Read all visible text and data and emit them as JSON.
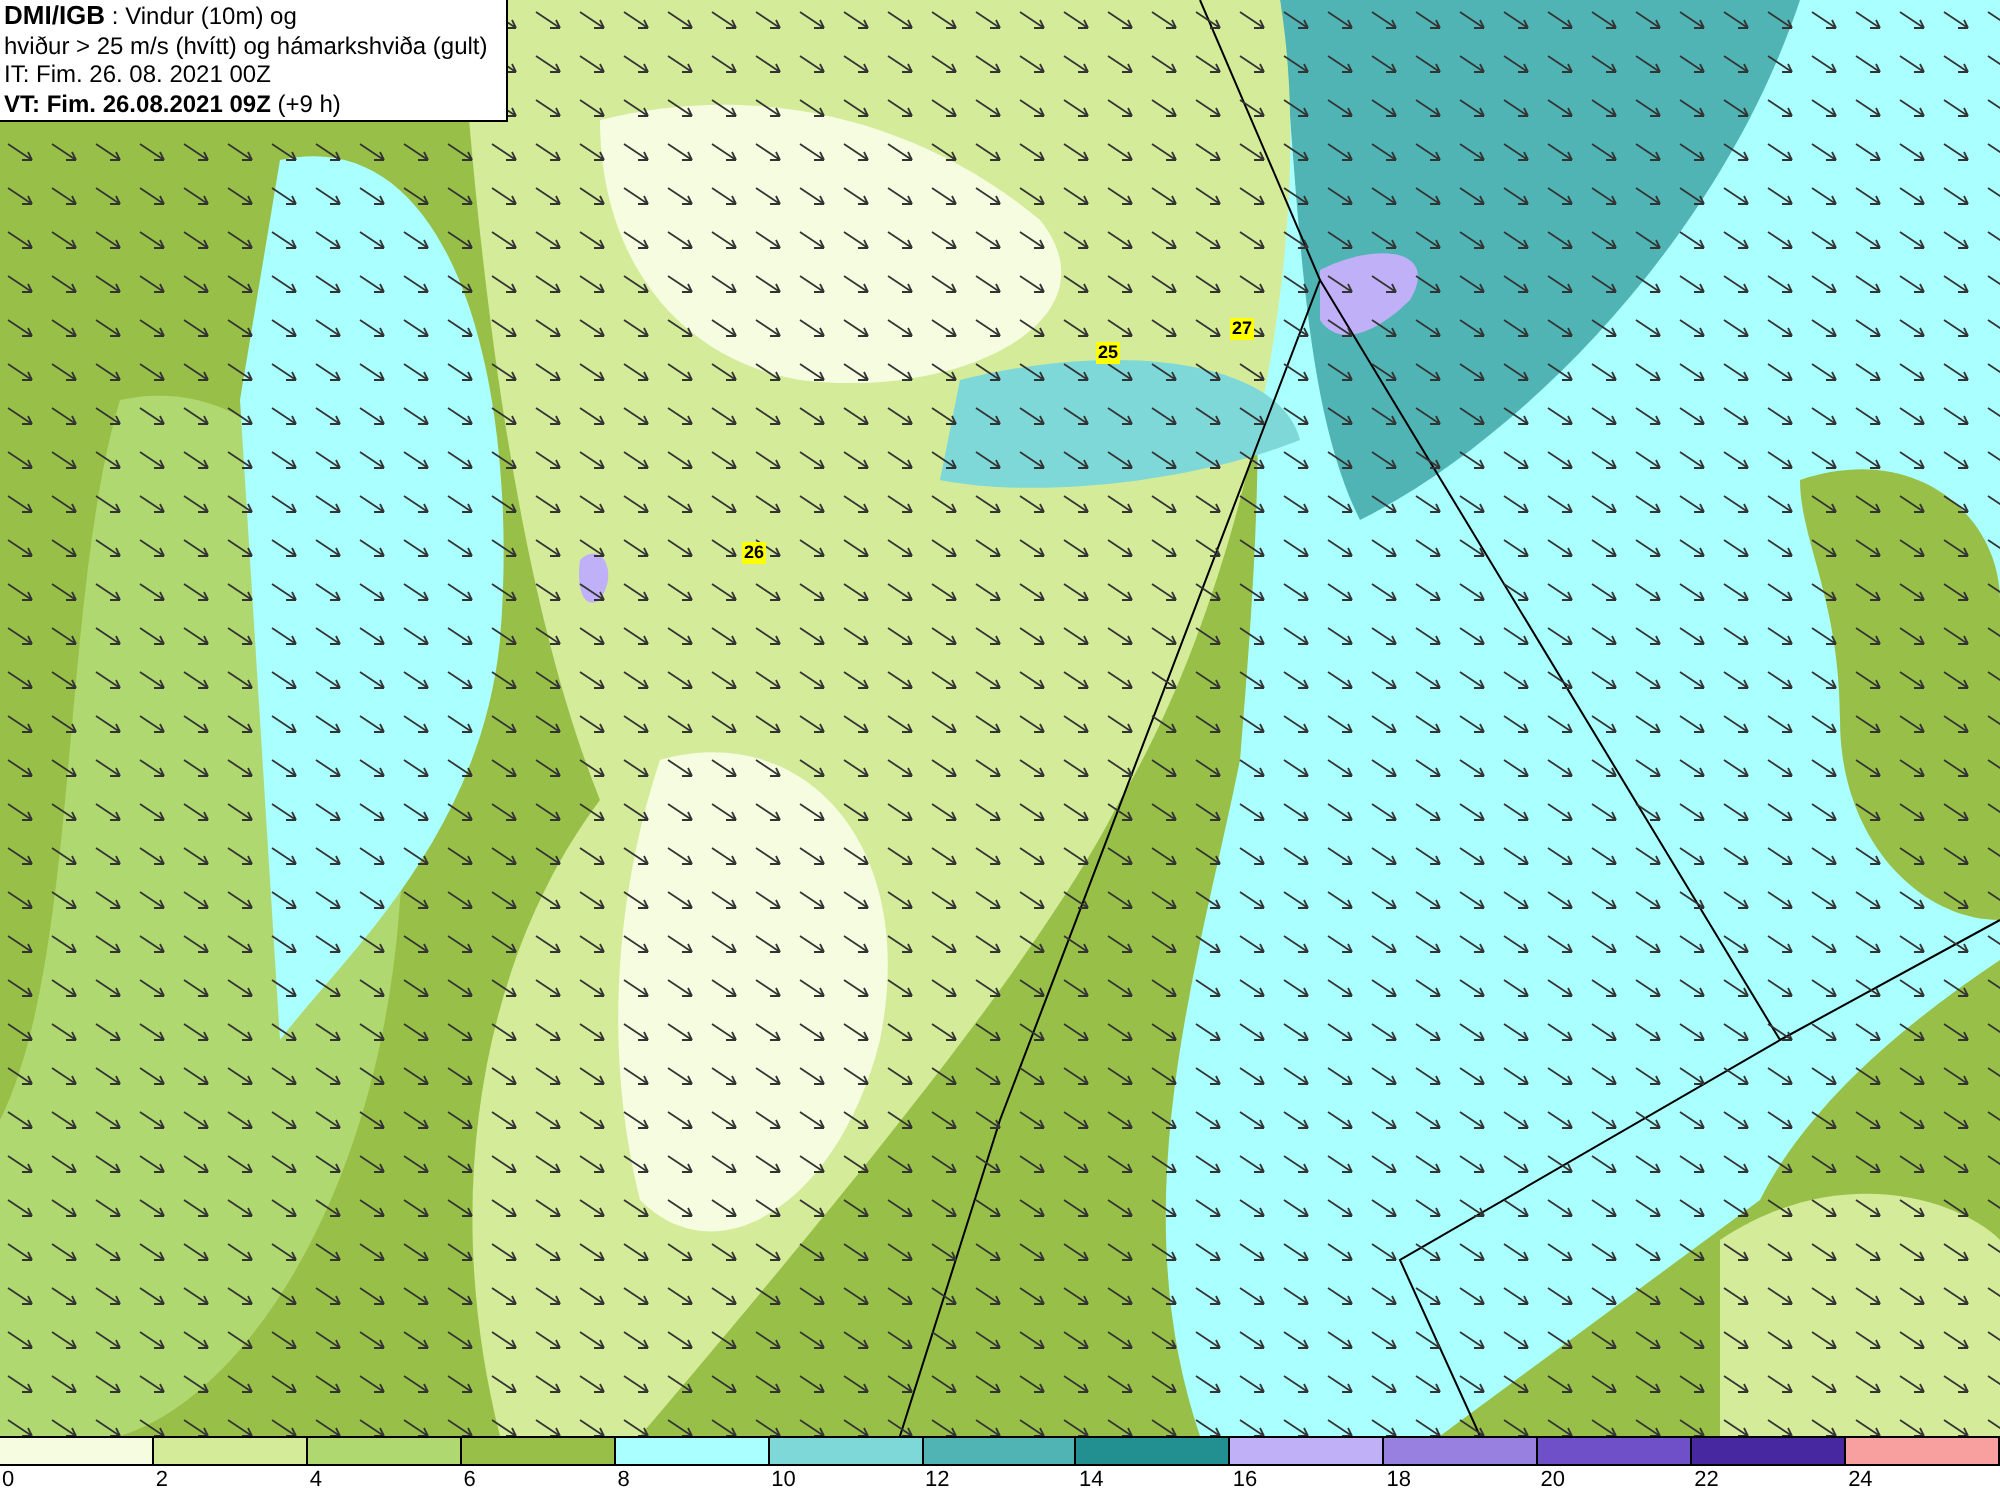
{
  "header": {
    "title": "**DMI/IGB** : Vindur (10m) og",
    "subtitle": "hviður > 25 m/s (hvítt) og hámarkshviða (gult)",
    "initial_time": "IT: Fim. 26. 08. 2021 00Z",
    "valid_time": "**VT: Fim. 26.08.2021 09Z** (+9 h)"
  },
  "gust_labels": [
    {
      "value": "25"
    },
    {
      "value": "27"
    },
    {
      "value": "26"
    }
  ],
  "legend": {
    "bins": [
      {
        "color": "#f5fce0"
      },
      {
        "color": "#d4ec9a"
      },
      {
        "color": "#b0d870"
      },
      {
        "color": "#98c048"
      },
      {
        "color": "#aaffff"
      },
      {
        "color": "#7ed8d8"
      },
      {
        "color": "#50b4b4"
      },
      {
        "color": "#229090"
      },
      {
        "color": "#c0b0f8"
      },
      {
        "color": "#9880e0"
      },
      {
        "color": "#7050c8"
      },
      {
        "color": "#4828a0"
      },
      {
        "color": "#f8a0a0"
      }
    ],
    "ticks": [
      "0",
      "2",
      "4",
      "6",
      "8",
      "10",
      "12",
      "14",
      "16",
      "18",
      "20",
      "22",
      "24"
    ]
  }
}
